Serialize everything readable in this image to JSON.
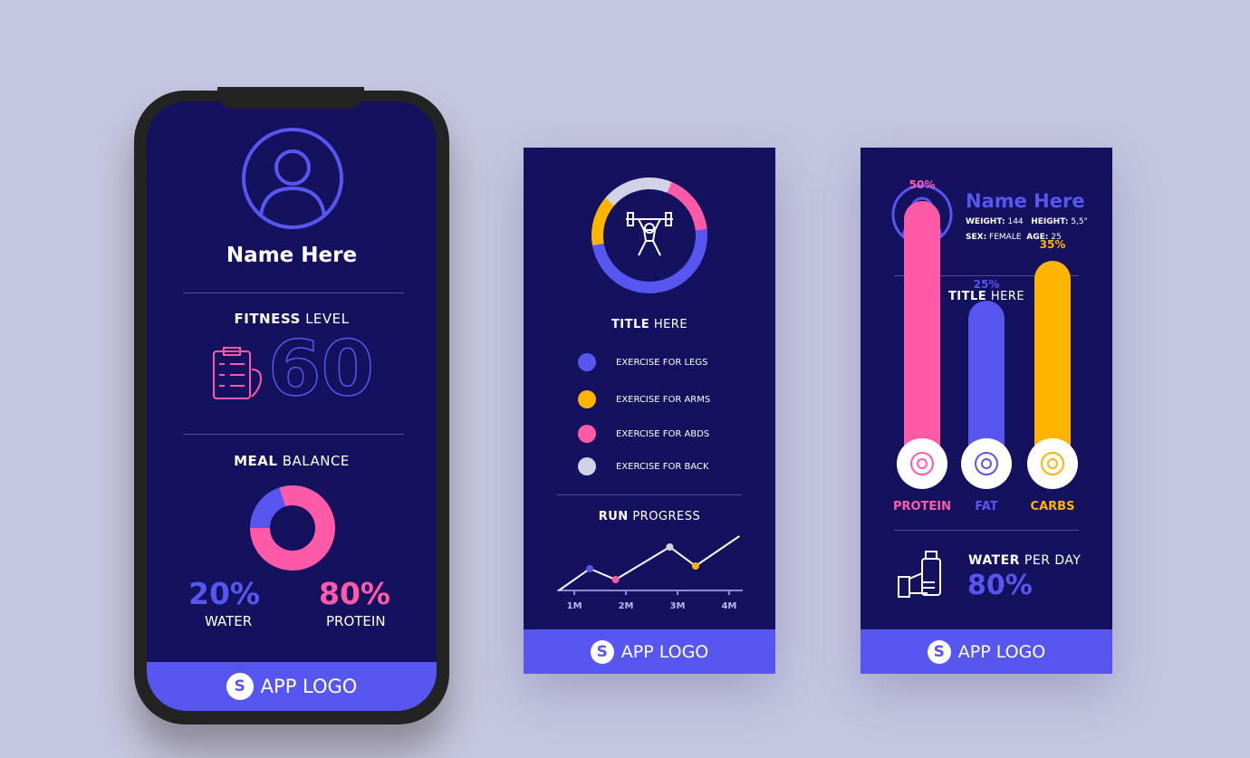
{
  "colors": {
    "background": "#c5c6e0",
    "panel": "#14125e",
    "accent": "#5856f0",
    "pink": "#ff5aa8",
    "yellow": "#ffb400",
    "gray": "#d2d2e6"
  },
  "phone": {
    "name": "Name Here",
    "fitness": {
      "bold": "FITNESS",
      "rest": " LEVEL",
      "value": "60"
    },
    "meal": {
      "bold": "MEAL",
      "rest": " BALANCE",
      "water_pct": "20%",
      "water_label": "WATER",
      "protein_pct": "80%",
      "protein_label": "PROTEIN",
      "water_fraction": 0.2
    },
    "footer": {
      "logo_letter": "S",
      "label": "APP LOGO"
    }
  },
  "panel2": {
    "ring": [
      {
        "color": "#ffb400",
        "fraction": 0.14
      },
      {
        "color": "#d2d2e6",
        "fraction": 0.2
      },
      {
        "color": "#ff5aa8",
        "fraction": 0.17
      },
      {
        "color": "#5856f0",
        "fraction": 0.49
      }
    ],
    "title": {
      "bold": "TITLE",
      "rest": " HERE"
    },
    "legend": [
      {
        "label": "EXERCISE FOR LEGS",
        "color": "#5856f0"
      },
      {
        "label": "EXERCISE FOR ARMS",
        "color": "#ffb400"
      },
      {
        "label": "EXERCISE FOR ABDS",
        "color": "#ff5aa8"
      },
      {
        "label": "EXERCISE FOR BACK",
        "color": "#d2d2e6"
      }
    ],
    "run": {
      "bold": "RUN",
      "rest": " PROGRESS"
    },
    "footer": {
      "logo_letter": "S",
      "label": "APP LOGO"
    }
  },
  "chart_data": {
    "type": "line",
    "title": "RUN PROGRESS",
    "categories": [
      "1M",
      "2M",
      "3M",
      "4M"
    ],
    "x": [
      0.7,
      1.3,
      1.8,
      2.85,
      3.35,
      4.2
    ],
    "y": [
      0,
      4,
      2,
      8,
      4.5,
      10
    ],
    "marker_colors": [
      null,
      "#5856f0",
      "#ff5aa8",
      "#d2d2e6",
      "#ffb400",
      null
    ],
    "xlim": [
      0.7,
      4.3
    ],
    "ylim": [
      0,
      10
    ],
    "grid": false
  },
  "panel3": {
    "name": "Name Here",
    "stats": [
      {
        "k": "WEIGHT:",
        "v": "144"
      },
      {
        "k": "HEIGHT:",
        "v": "5,5\""
      },
      {
        "k": "SEX:",
        "v": "FEMALE"
      },
      {
        "k": "AGE:",
        "v": "25"
      }
    ],
    "title": {
      "bold": "TITLE",
      "rest": " HERE"
    },
    "bars": [
      {
        "label": "PROTEIN",
        "pct": "50%",
        "value": 50,
        "color": "#ff5aa8",
        "icon": "steak-icon"
      },
      {
        "label": "FAT",
        "pct": "25%",
        "value": 25,
        "color": "#5856f0",
        "icon": "avocado-icon"
      },
      {
        "label": "CARBS",
        "pct": "35%",
        "value": 35,
        "color": "#ffb400",
        "icon": "rice-bowl-icon"
      }
    ],
    "water": {
      "bold": "WATER",
      "rest": " PER DAY",
      "value": "80%"
    },
    "footer": {
      "logo_letter": "S",
      "label": "APP LOGO"
    }
  }
}
